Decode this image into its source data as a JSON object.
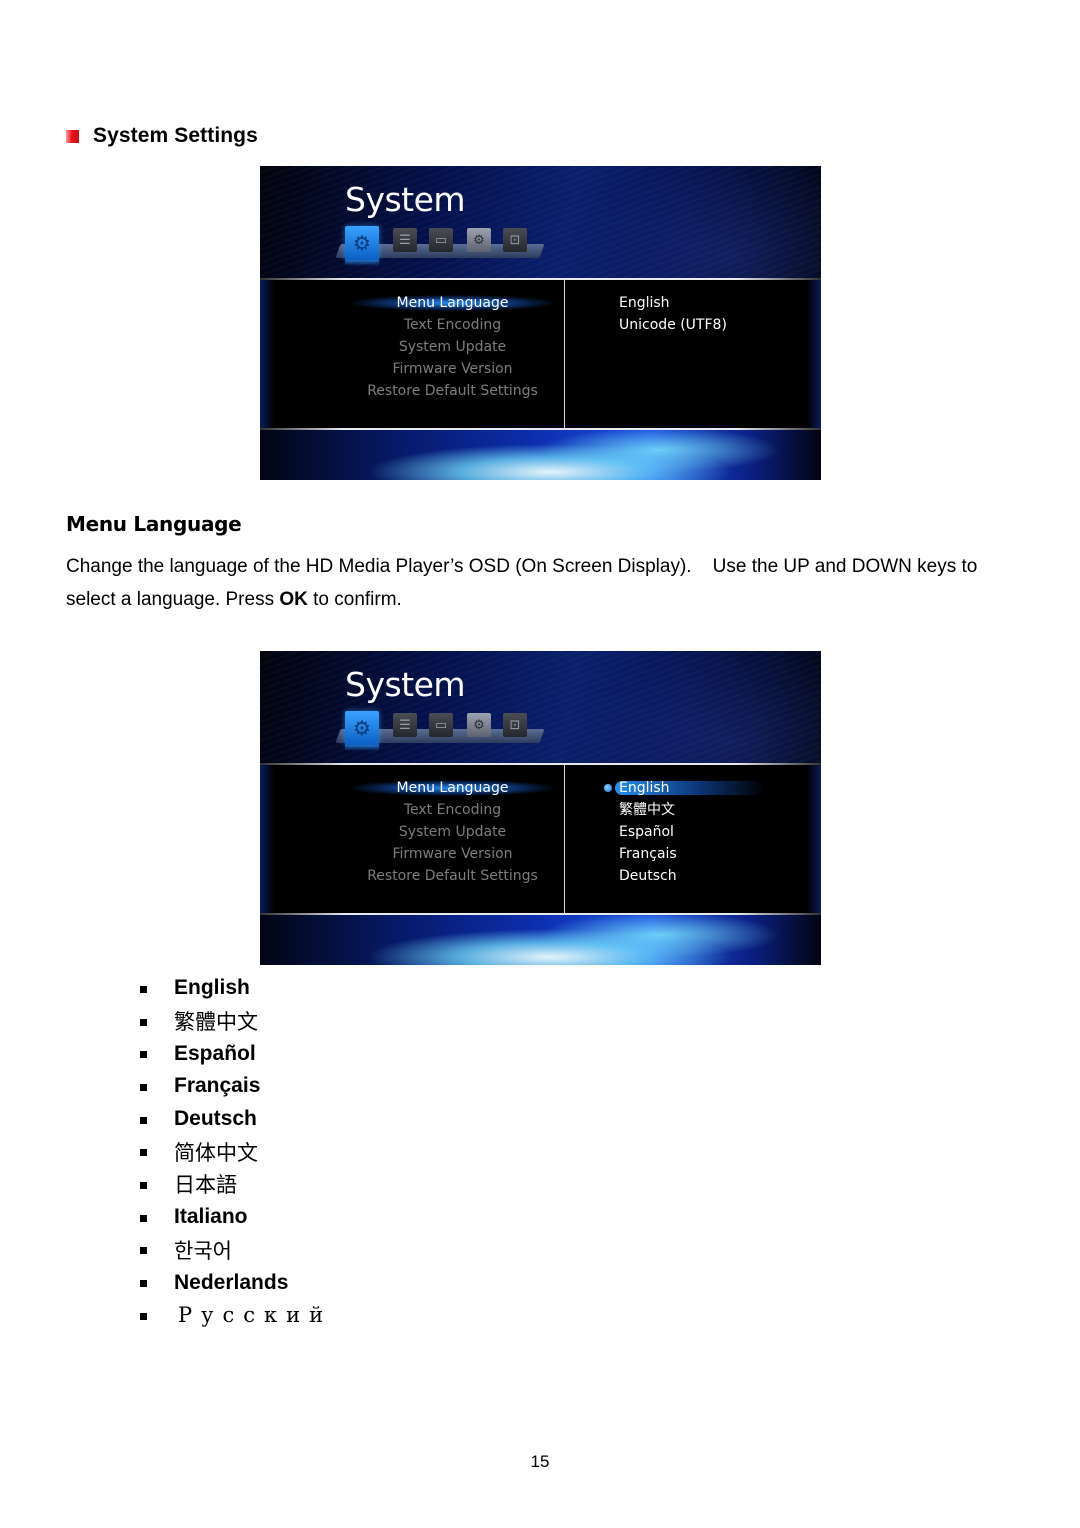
{
  "section": {
    "title": "System Settings",
    "bullet_color": "#e8141a"
  },
  "screens": [
    {
      "title": "System",
      "tabs": [
        "system-gear-icon",
        "adjust-sliders-icon",
        "tv-icon",
        "settings-gear-icon",
        "network-icon"
      ],
      "active_tab": 0,
      "menu": [
        "Menu Language",
        "Text Encoding",
        "System Update",
        "Firmware Version",
        "Restore Default Settings"
      ],
      "selected_menu": 0,
      "values": [
        "English",
        "Unicode (UTF8)"
      ]
    },
    {
      "title": "System",
      "tabs": [
        "system-gear-icon",
        "adjust-sliders-icon",
        "tv-icon",
        "settings-gear-icon",
        "network-icon"
      ],
      "active_tab": 0,
      "menu": [
        "Menu Language",
        "Text Encoding",
        "System Update",
        "Firmware Version",
        "Restore Default Settings"
      ],
      "selected_menu": 0,
      "values": [
        "English",
        "繁體中文",
        "Español",
        "Français",
        "Deutsch"
      ],
      "selected_value": 0
    }
  ],
  "menu_language": {
    "heading": "Menu Language",
    "para_1": "Change the language of the HD Media Player’s OSD (On Screen Display).    Use the UP and DOWN keys to select a language. Press ",
    "para_bold": "OK",
    "para_2": " to confirm."
  },
  "languages": [
    {
      "label": "English",
      "style": "latin"
    },
    {
      "label": "繁體中文",
      "style": "cjk"
    },
    {
      "label": "Español",
      "style": "latin"
    },
    {
      "label": "Français",
      "style": "latin"
    },
    {
      "label": "Deutsch",
      "style": "latin"
    },
    {
      "label": "简体中文",
      "style": "cjk"
    },
    {
      "label": "日本語",
      "style": "cjk"
    },
    {
      "label": "Italiano",
      "style": "latin"
    },
    {
      "label": "한국어",
      "style": "cjk"
    },
    {
      "label": "Nederlands",
      "style": "latin"
    },
    {
      "label": "Русский",
      "style": "ru"
    }
  ],
  "page_number": "15"
}
